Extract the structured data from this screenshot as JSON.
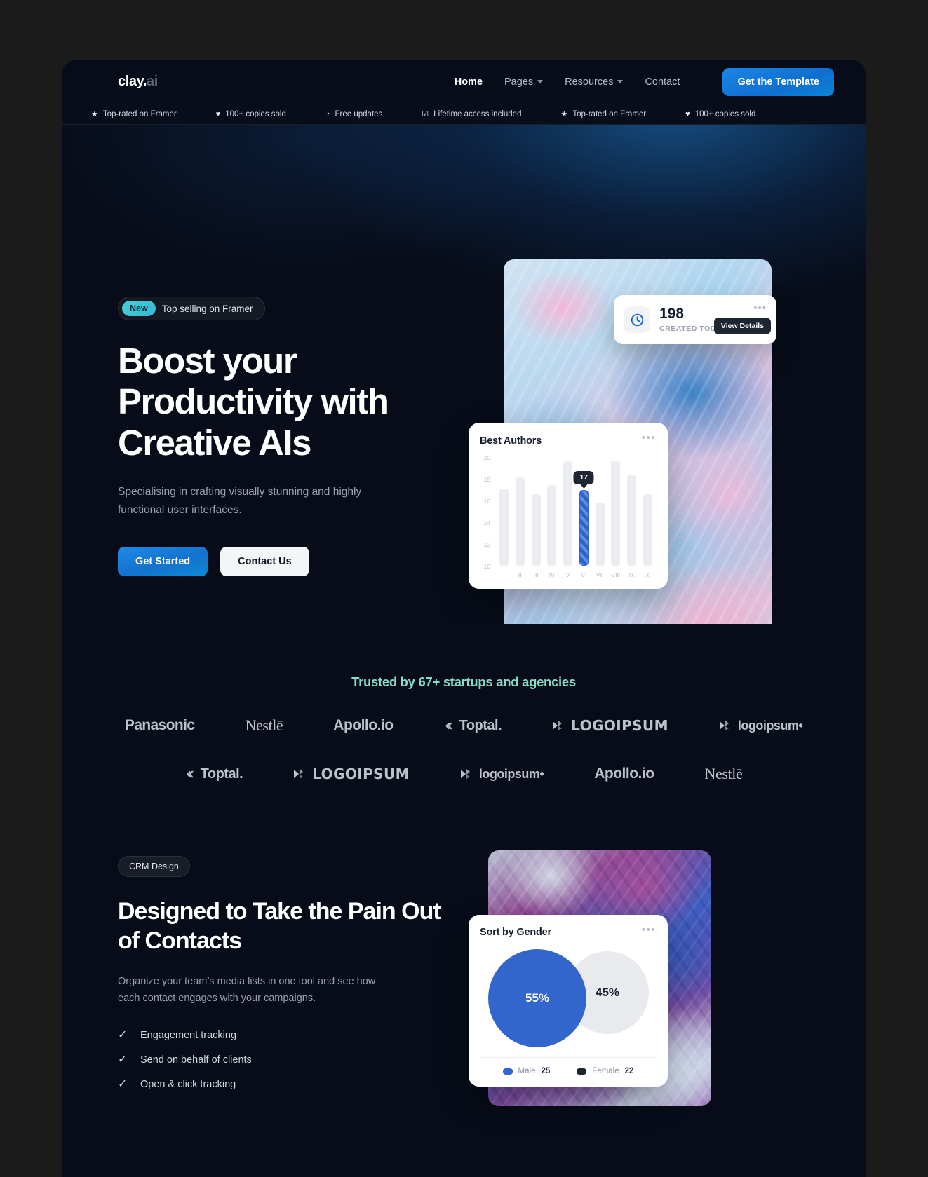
{
  "brand": {
    "name_white": "clay.",
    "name_dim": "ai"
  },
  "nav": {
    "links": [
      {
        "label": "Home",
        "has_caret": false
      },
      {
        "label": "Pages",
        "has_caret": true
      },
      {
        "label": "Resources",
        "has_caret": true
      },
      {
        "label": "Contact",
        "has_caret": false
      }
    ],
    "cta_label": "Get the Template"
  },
  "marquee": [
    {
      "icon": "star-icon",
      "glyph": "★",
      "label": "Top-rated on Framer"
    },
    {
      "icon": "heart-icon",
      "glyph": "♥",
      "label": "100+ copies sold"
    },
    {
      "icon": "clock-icon",
      "glyph": "◔",
      "label": "Free updates"
    },
    {
      "icon": "shield-check-icon",
      "glyph": "☑",
      "label": "Lifetime access included"
    },
    {
      "icon": "star-icon",
      "glyph": "★",
      "label": "Top-rated on Framer"
    },
    {
      "icon": "heart-icon",
      "glyph": "♥",
      "label": "100+ copies sold"
    }
  ],
  "hero": {
    "badge_new": "New",
    "badge_text": "Top selling on Framer",
    "heading": "Boost your Productivity with Creative AIs",
    "subheading": "Specialising in crafting visually stunning and highly functional user interfaces.",
    "primary_btn": "Get Started",
    "secondary_btn": "Contact Us",
    "notification": {
      "count": "198",
      "label": "CREATED TODAY",
      "tooltip": "View Details",
      "dots": "•••"
    },
    "bar_card": {
      "title": "Best Authors",
      "dots": "•••"
    }
  },
  "trusted": {
    "heading": "Trusted by 67+ startups and agencies",
    "row1": [
      {
        "name": "Panasonic",
        "style": "b-panasonic"
      },
      {
        "name": "Nestlē",
        "style": "b-nestle"
      },
      {
        "name": "Apollo.io",
        "style": "b-apollo"
      },
      {
        "name": "Toptal.",
        "style": "b-toptal"
      },
      {
        "name": "LOGOIPSUM",
        "style": "b-logoipsum-caps"
      },
      {
        "name": "logoipsum•",
        "style": "b-logoipsum-low"
      }
    ],
    "row2": [
      {
        "name": "Toptal.",
        "style": "b-toptal"
      },
      {
        "name": "LOGOIPSUM",
        "style": "b-logoipsum-caps"
      },
      {
        "name": "logoipsum•",
        "style": "b-logoipsum-low"
      },
      {
        "name": "Apollo.io",
        "style": "b-apollo"
      },
      {
        "name": "Nestlē",
        "style": "b-nestle"
      }
    ]
  },
  "crm": {
    "tag": "CRM Design",
    "heading": "Designed to Take the Pain Out of Contacts",
    "paragraph": "Organize your team’s media lists in one tool and see how each contact engages with your campaigns.",
    "features": [
      {
        "glyph": "✓",
        "label": "Engagement tracking"
      },
      {
        "glyph": "✓",
        "label": "Send on behalf of clients"
      },
      {
        "glyph": "✓",
        "label": "Open & click tracking"
      }
    ],
    "pie_card": {
      "title": "Sort by Gender",
      "dots": "•••"
    }
  },
  "colors": {
    "page_bg": "#070c18",
    "accent_blue": "#1d8ce8",
    "accent_mint": "#86ddc4",
    "badge_teal": "#3fd3d8",
    "chart_blue": "#3366cc",
    "chart_gray": "#e9eaee"
  },
  "chart_data": [
    {
      "type": "bar",
      "title": "Best Authors",
      "categories": [
        "I",
        "II",
        "III",
        "IV",
        "V",
        "VI",
        "VII",
        "VIII",
        "IX",
        "X"
      ],
      "values": [
        17.1,
        18.1,
        16.6,
        17.4,
        19.6,
        17,
        15.8,
        19.7,
        18.3,
        16.6
      ],
      "highlight_index": 5,
      "highlight_label": "17",
      "xlabel": "",
      "ylabel": "",
      "ylim": [
        10,
        20
      ],
      "yticks": [
        20,
        18,
        16,
        14,
        12,
        10
      ],
      "grid": false,
      "legend": "none"
    },
    {
      "type": "pie",
      "title": "Sort by Gender",
      "labels": [
        "Male",
        "Female"
      ],
      "values": [
        55,
        45
      ],
      "value_labels": [
        "55%",
        "45%"
      ],
      "counts": [
        "25",
        "22"
      ],
      "colors": [
        "#3366cc",
        "#e9eaee"
      ],
      "legend": "bottom"
    }
  ]
}
